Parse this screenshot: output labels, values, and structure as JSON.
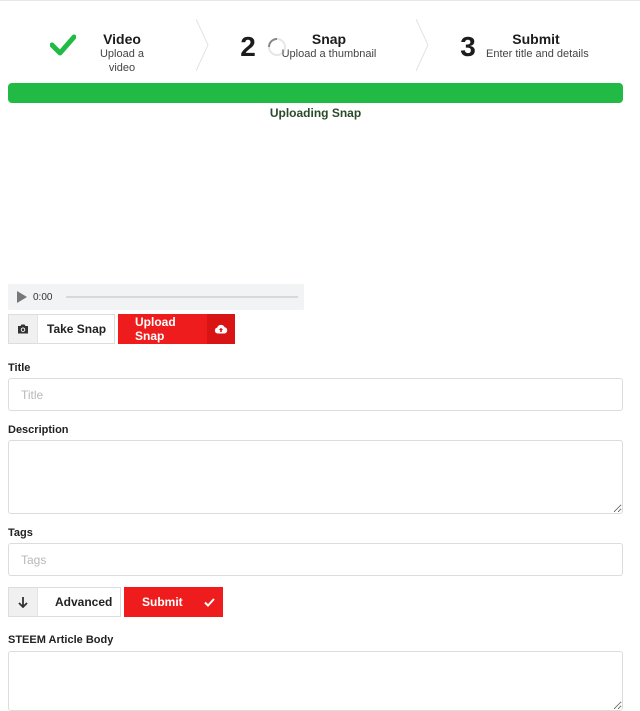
{
  "steps": [
    {
      "title": "Video",
      "desc": "Upload a video",
      "status": "completed",
      "icon": "check-icon"
    },
    {
      "num": "2",
      "title": "Snap",
      "desc": "Upload a thumbnail",
      "status": "active",
      "icon": "spinner-icon"
    },
    {
      "num": "3",
      "title": "Submit",
      "desc": "Enter title and details",
      "status": "pending"
    }
  ],
  "progress": {
    "label": "Uploading Snap",
    "percent": 100,
    "color": "#21ba45"
  },
  "audio": {
    "time": "0:00"
  },
  "snap_buttons": {
    "take": "Take Snap",
    "upload": "Upload Snap"
  },
  "form": {
    "title_label": "Title",
    "title_placeholder": "Title",
    "description_label": "Description",
    "tags_label": "Tags",
    "tags_placeholder": "Tags",
    "advanced": "Advanced",
    "submit": "Submit",
    "article_label": "STEEM Article Body"
  },
  "colors": {
    "accent_red": "#ee1c1c",
    "success_green": "#21ba45"
  }
}
